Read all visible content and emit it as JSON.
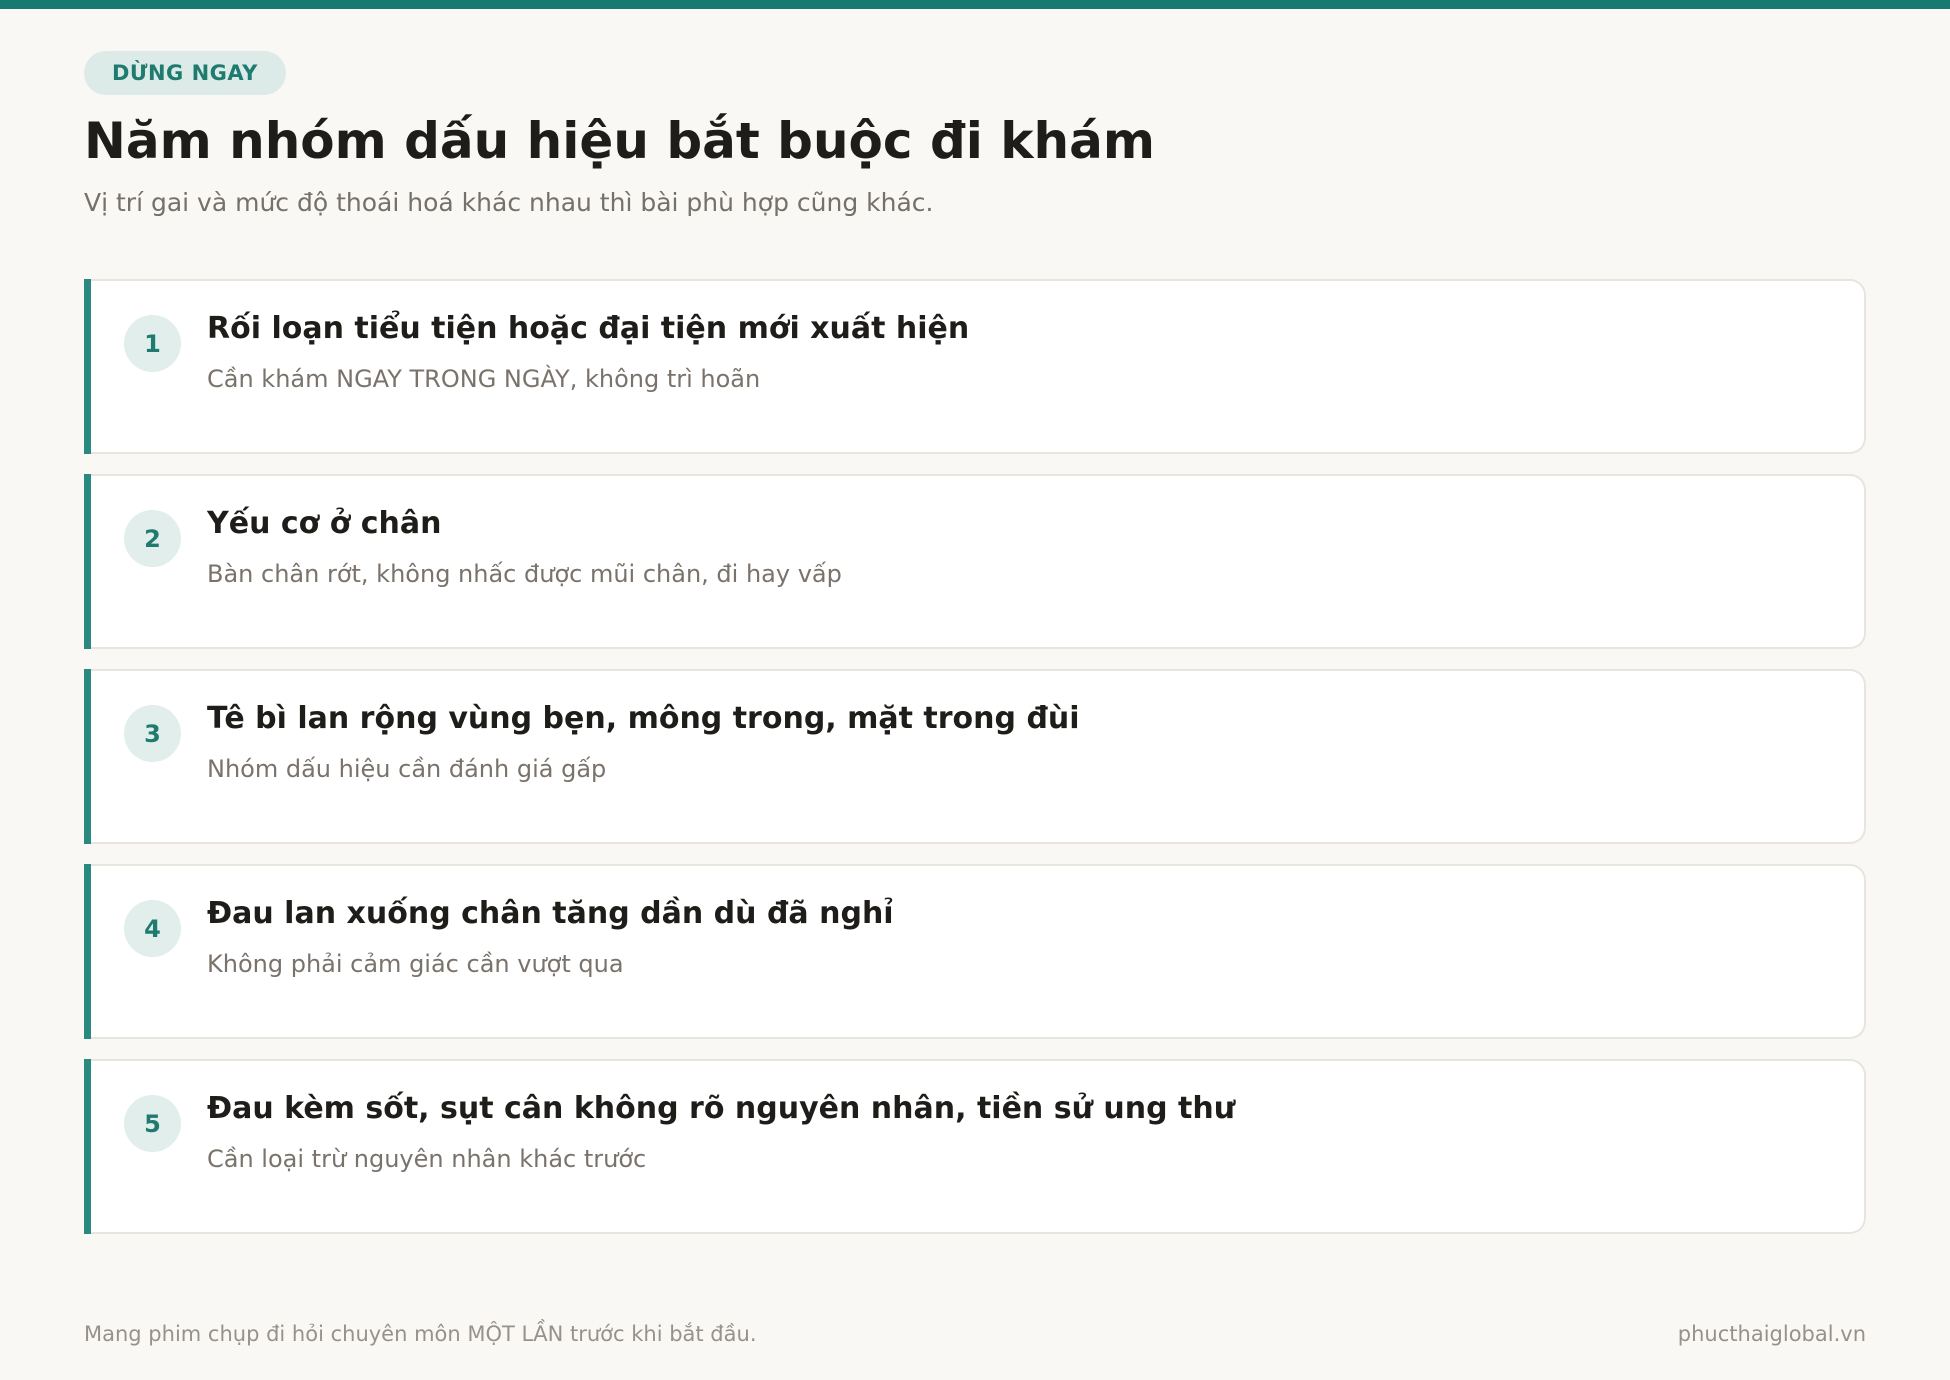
{
  "badge": "DỪNG NGAY",
  "title": "Năm nhóm dấu hiệu bắt buộc đi khám",
  "subtitle": "Vị trí gai và mức độ thoái hoá khác nhau thì bài phù hợp cũng khác.",
  "items": [
    {
      "num": "1",
      "title": "Rối loạn tiểu tiện hoặc đại tiện mới xuất hiện",
      "desc": "Cần khám NGAY TRONG NGÀY, không trì hoãn"
    },
    {
      "num": "2",
      "title": "Yếu cơ ở chân",
      "desc": "Bàn chân rớt, không nhấc được mũi chân, đi hay vấp"
    },
    {
      "num": "3",
      "title": "Tê bì lan rộng vùng bẹn, mông trong, mặt trong đùi",
      "desc": "Nhóm dấu hiệu cần đánh giá gấp"
    },
    {
      "num": "4",
      "title": "Đau lan xuống chân tăng dần dù đã nghỉ",
      "desc": "Không phải cảm giác cần vượt qua"
    },
    {
      "num": "5",
      "title": "Đau kèm sốt, sụt cân không rõ nguyên nhân, tiền sử ung thư",
      "desc": "Cần loại trừ nguyên nhân khác trước"
    }
  ],
  "footer": {
    "note": "Mang phim chụp đi hỏi chuyên môn MỘT LẦN trước khi bắt đầu.",
    "site": "phucthaiglobal.vn"
  },
  "colors": {
    "accent": "#177a70",
    "badge_bg": "#dcebe7",
    "background": "#f9f8f5"
  }
}
